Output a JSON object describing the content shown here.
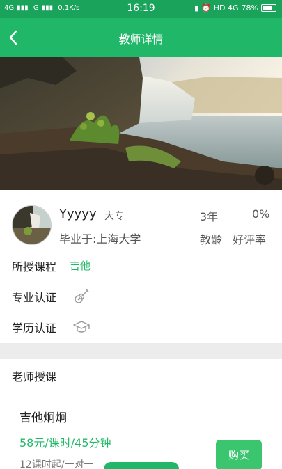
{
  "status_bar": {
    "sim1": "4G",
    "sim2": "G",
    "speed": "0.1K/s",
    "time": "16:19",
    "network": "HD 4G",
    "battery": "78%"
  },
  "nav": {
    "title": "教师详情"
  },
  "teacher": {
    "name": "Yyyyy",
    "education": "大专",
    "graduated_from": "毕业于:上海大学",
    "years": "3年",
    "years_label": "教龄",
    "rating": "0%",
    "rating_label": "好评率"
  },
  "rows": {
    "courses_label": "所授课程",
    "course_tag": "吉他",
    "professional_cert_label": "专业认证",
    "education_cert_label": "学历认证"
  },
  "lessons": {
    "section_title": "老师授课",
    "items": [
      {
        "name": "吉他炯炯",
        "price": "58元/课时/45分钟",
        "detail": "12课时起/一对一",
        "buy_label": "购买"
      }
    ]
  },
  "colors": {
    "status_bar": "#1aa35a",
    "nav_bar": "#20b868",
    "accent": "#20b868",
    "buy_button": "#3cc56f"
  },
  "icons": {
    "back": "chevron-left-icon",
    "professional_cert": "guitar-icon",
    "education_cert": "graduation-cap-icon"
  }
}
